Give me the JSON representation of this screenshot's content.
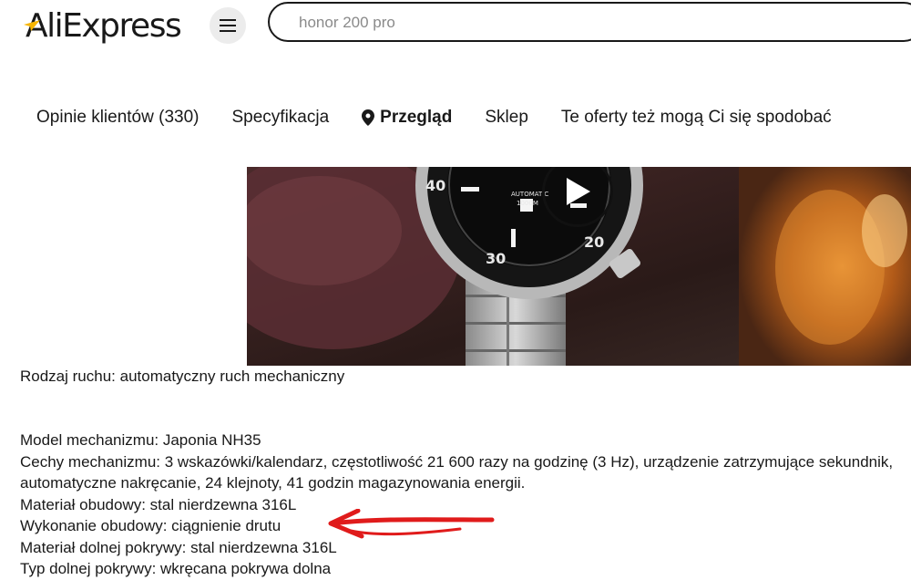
{
  "header": {
    "logo_text": "AliExpress",
    "menu_icon": "hamburger-menu-icon",
    "search": {
      "value": "",
      "placeholder": "honor 200 pro"
    }
  },
  "tabs": [
    {
      "label": "Opinie klientów (330)",
      "active": false
    },
    {
      "label": "Specyfikacja",
      "active": false
    },
    {
      "label": "Przegląd",
      "active": true,
      "icon": "location-pin-icon"
    },
    {
      "label": "Sklep",
      "active": false
    },
    {
      "label": "Te oferty też mogą Ci się spodobać",
      "active": false
    }
  ],
  "video": {
    "play_icon": "play-icon"
  },
  "description": {
    "movement_type": "Rodzaj ruchu: automatyczny ruch mechaniczny",
    "lines": [
      "Model mechanizmu: Japonia NH35",
      "Cechy mechanizmu: 3 wskazówki/kalendarz, częstotliwość 21 600 razy na godzinę (3 Hz), urządzenie zatrzymujące sekundnik,",
      "automatyczne nakręcanie, 24 klejnoty, 41 godzin magazynowania energii.",
      "Materiał obudowy: stal nierdzewna 316L",
      "Wykonanie obudowy: ciągnienie drutu",
      "Materiał dolnej pokrywy: stal nierdzewna 316L",
      "Typ dolnej pokrywy: wkręcana pokrywa dolna"
    ]
  },
  "annotation": {
    "arrow_color": "#e01b1b"
  },
  "colors": {
    "brand_star": "#f7b500",
    "text": "#191919",
    "menu_bg": "#ececec"
  }
}
